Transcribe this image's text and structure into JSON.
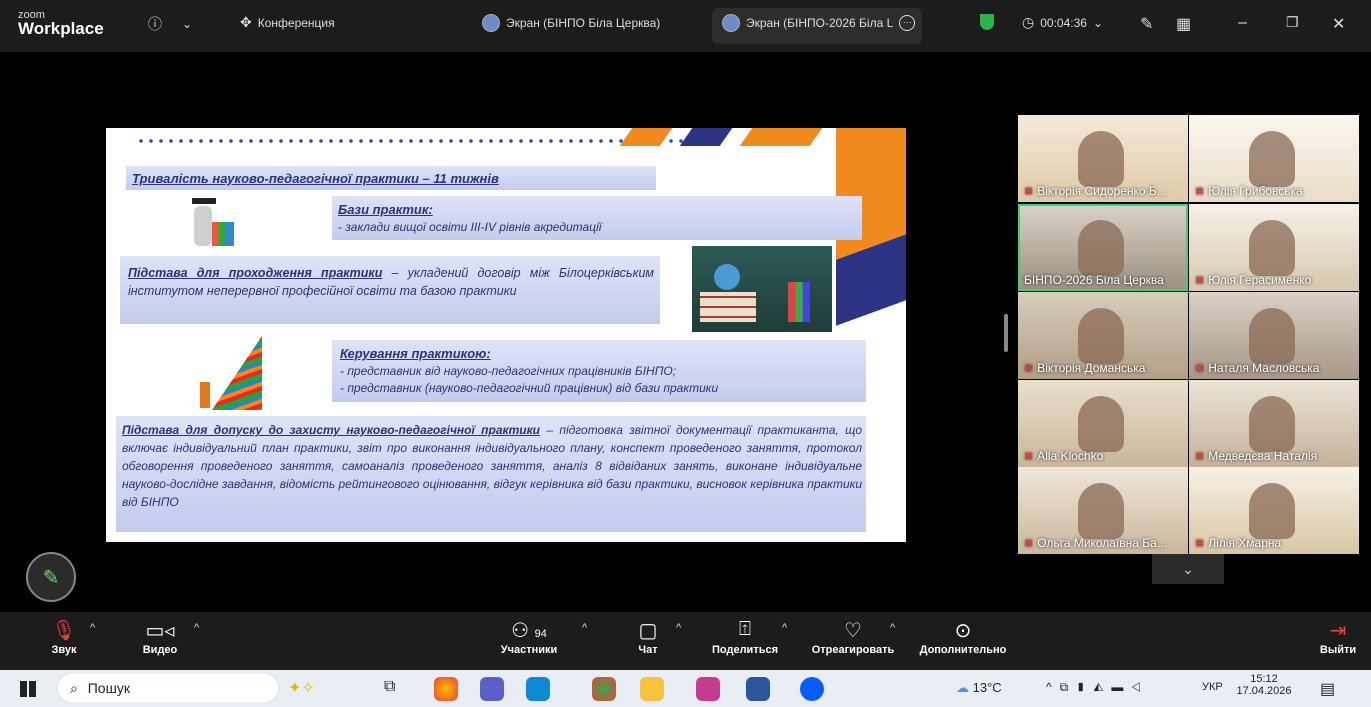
{
  "app": {
    "logo_small": "zoom",
    "logo_large": "Workplace"
  },
  "titlebar": {
    "info_icon": "info-icon",
    "conference_label": "Конференция",
    "tab1_label": "Экран (БІНПО Біла Церква)",
    "tab2_label": "Экран (БІНПО-2026 Біла L",
    "timer": "00:04:36"
  },
  "slide": {
    "line1": "Тривалість науково-педагогічної практики – 11 тижнів",
    "bases_title": "Бази практик:",
    "bases_text": "- заклади вищої освіти ІІІ-IV рівнів акредитації",
    "basis_title": "Підстава для проходження практики",
    "basis_text": " – укладений договір між Білоцерківським інститутом неперервної професійної освіти та базою практики",
    "mgmt_title": "Керування практикою:",
    "mgmt_line1": "- представник від науково-педагогічних працівників БІНПО;",
    "mgmt_line2": "- представник (науково-педагогічний працівник) від бази практики",
    "defense_title": "Підстава для допуску до захисту науково-педагогічної практики",
    "defense_text": " – підготовка звітної документації практиканта, що включає індивідуальний план практики, звіт про виконання індивідуального плану, конспект проведеного заняття, протокол обговорення проведеного заняття, самоаналіз проведеного заняття, аналіз 8 відвіданих занять, виконане індивідуальне науково-дослідне завдання, відомість рейтингового оцінювання, відгук керівника від бази практики, висновок керівника практики від БІНПО"
  },
  "participants": [
    {
      "name": "Вікторія Сидоренко Б...",
      "muted": true
    },
    {
      "name": "Юлія Грибовська",
      "muted": true
    },
    {
      "name": "БІНПО-2026 Біла Церква",
      "muted": false
    },
    {
      "name": "Юлія Герасименко",
      "muted": true
    },
    {
      "name": "Вікторія Доманська",
      "muted": true
    },
    {
      "name": "Наталя Масловська",
      "muted": true
    },
    {
      "name": "Alla Klochko",
      "muted": true
    },
    {
      "name": "Медведєва Наталія",
      "muted": true
    },
    {
      "name": "Ольга Миколаївна Ба...",
      "muted": true
    },
    {
      "name": "Лілія Хмарна",
      "muted": true
    }
  ],
  "toolbar": {
    "audio": "Звук",
    "video": "Видео",
    "participants_count": "94",
    "participants": "Участники",
    "chat": "Чат",
    "share": "Поделиться",
    "react": "Отреагировать",
    "more": "Дополнительно",
    "leave": "Выйти"
  },
  "taskbar": {
    "search": "Пошук",
    "weather": "13°C",
    "lang": "УКР",
    "time": "15:12",
    "date": "17.04.2026"
  }
}
